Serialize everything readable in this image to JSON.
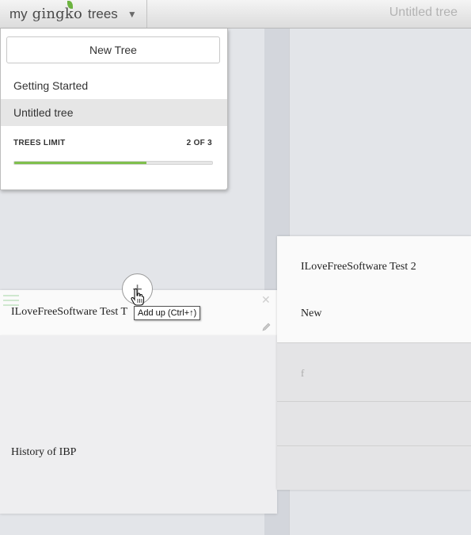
{
  "header": {
    "logo": {
      "my": "my",
      "gingko": "gingko",
      "trees": "trees",
      "caret": "▼"
    },
    "document_title": "Untitled tree"
  },
  "trees_menu": {
    "new_tree_label": "New Tree",
    "items": [
      {
        "label": "Getting Started",
        "selected": false
      },
      {
        "label": "Untitled tree",
        "selected": true
      }
    ],
    "limit_label": "TREES LIMIT",
    "limit_count": "2 OF 3",
    "limit_used": 2,
    "limit_total": 3,
    "limit_fraction": 0.667
  },
  "tree": {
    "left_cards": [
      {
        "text": "ILoveFreeSoftware Test T",
        "active": true
      },
      {
        "text": "History of IBP",
        "active": false
      }
    ],
    "right_cards": [
      {
        "lines": [
          "ILoveFreeSoftware Test 2",
          "New"
        ]
      },
      {
        "lines": [
          "f"
        ]
      },
      {
        "lines": []
      },
      {
        "lines": []
      }
    ]
  },
  "add_up": {
    "icon": "plus-icon",
    "tooltip": "Add up (Ctrl+↑)"
  },
  "colors": {
    "accent_green": "#7fbf4d",
    "leaf_green": "#6cb33f",
    "selected_item": "#e6e6e6"
  }
}
